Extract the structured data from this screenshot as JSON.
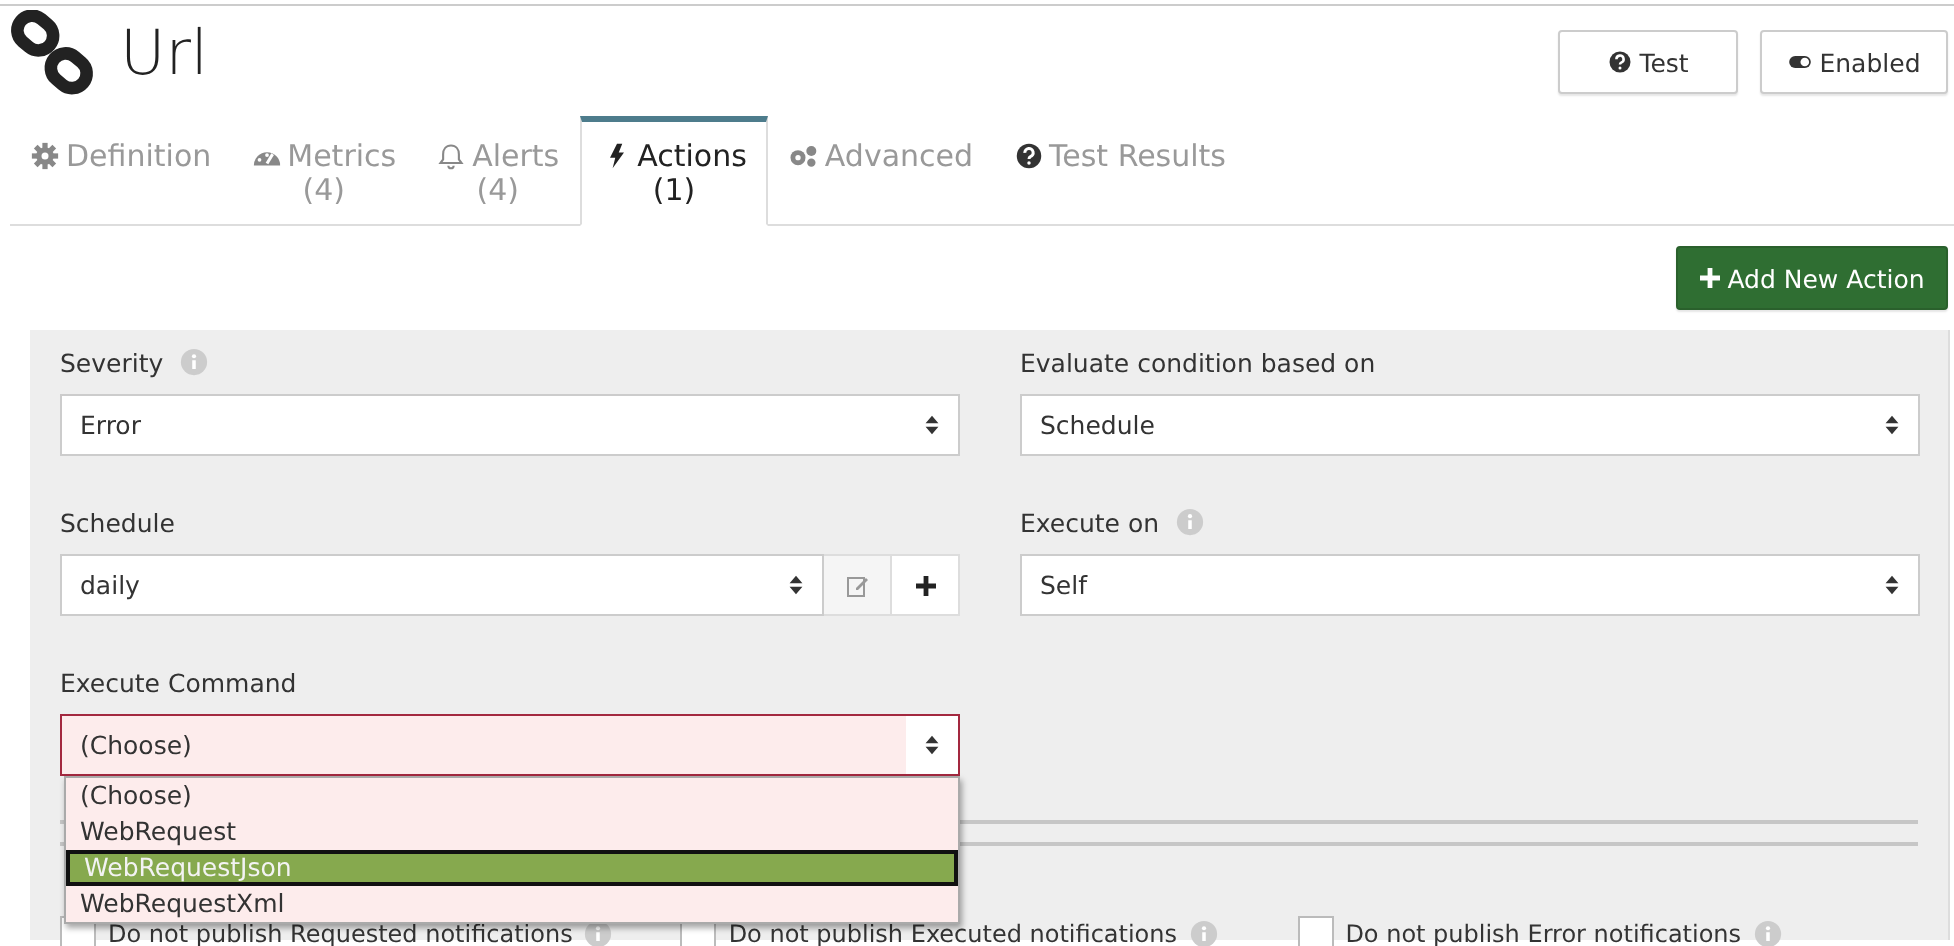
{
  "page": {
    "title": "Url"
  },
  "header_buttons": [
    {
      "label": "Test"
    },
    {
      "label": "Enabled"
    }
  ],
  "tabs": [
    {
      "label": "Definition",
      "selected": false
    },
    {
      "label": "Metrics",
      "count": "(4)",
      "selected": false
    },
    {
      "label": "Alerts",
      "count": "(4)",
      "selected": false
    },
    {
      "label": "Actions",
      "count": "(1)",
      "selected": true
    },
    {
      "label": "Advanced",
      "selected": false
    },
    {
      "label": "Test Results",
      "selected": false
    }
  ],
  "add_button": {
    "label": "Add New Action"
  },
  "fields": [
    {
      "label": "Severity",
      "info": true,
      "value": "Error",
      "kind": "select",
      "invalid": false
    },
    {
      "label": "Evaluate condition based on",
      "info": false,
      "value": "Schedule",
      "kind": "select",
      "invalid": false
    },
    {
      "label": "Schedule",
      "info": false,
      "value": "daily",
      "kind": "select-with-buttons",
      "invalid": false
    },
    {
      "label": "Execute on",
      "info": true,
      "value": "Self",
      "kind": "select",
      "invalid": false
    },
    {
      "label": "Execute Command",
      "info": false,
      "value": "(Choose)",
      "kind": "select",
      "invalid": true,
      "expanded": true,
      "options": [
        {
          "label": "(Choose)",
          "highlighted": false
        },
        {
          "label": "WebRequest",
          "highlighted": false
        },
        {
          "label": "WebRequestJson",
          "highlighted": true
        },
        {
          "label": "WebRequestXml",
          "highlighted": false
        }
      ]
    }
  ],
  "notifications": [
    {
      "label": "Do not publish Requested notifications",
      "checked": false,
      "info": true
    },
    {
      "label": "Do not publish Executed notifications",
      "checked": false,
      "info": true
    },
    {
      "label": "Do not publish Error notifications",
      "checked": false,
      "info": true
    }
  ]
}
